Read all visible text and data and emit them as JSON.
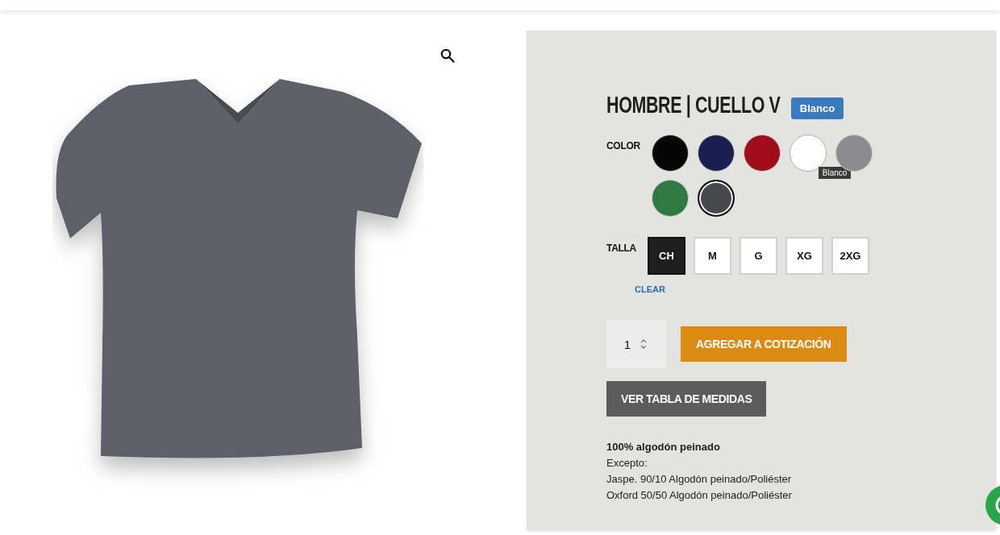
{
  "product": {
    "title": "HOMBRE | CUELLO V",
    "color_label": "COLOR",
    "colors": [
      {
        "color": "#050505",
        "selected": false,
        "hovered": false
      },
      {
        "color": "#1a1f52",
        "selected": false,
        "hovered": false
      },
      {
        "color": "#a10d1a",
        "selected": false,
        "hovered": false
      },
      {
        "color": "#ffffff",
        "selected": false,
        "hovered": true,
        "tooltip": "Blanco",
        "title_tip": "Blanco"
      },
      {
        "color": "#8b8b90",
        "selected": false,
        "hovered": false
      },
      {
        "color": "#2f7a44",
        "selected": false,
        "hovered": false
      },
      {
        "color": "#464950",
        "selected": true,
        "hovered": false
      }
    ],
    "size_label": "TALLA",
    "sizes": [
      {
        "label": "CH",
        "selected": true
      },
      {
        "label": "M",
        "selected": false
      },
      {
        "label": "G",
        "selected": false
      },
      {
        "label": "XG",
        "selected": false
      },
      {
        "label": "2XG",
        "selected": false
      }
    ],
    "clear_link": "CLEAR",
    "quantity": "1",
    "add_button": "AGREGAR A COTIZACIÓN",
    "size_chart_button": "VER TABLA DE MEDIDAS",
    "description": [
      "**100% algodón peinado**",
      "Excepto:",
      "Jaspe. 90/10 Algodón peinado/Poliéster",
      "Oxford 50/50 Algodón peinado/Poliéster"
    ]
  }
}
